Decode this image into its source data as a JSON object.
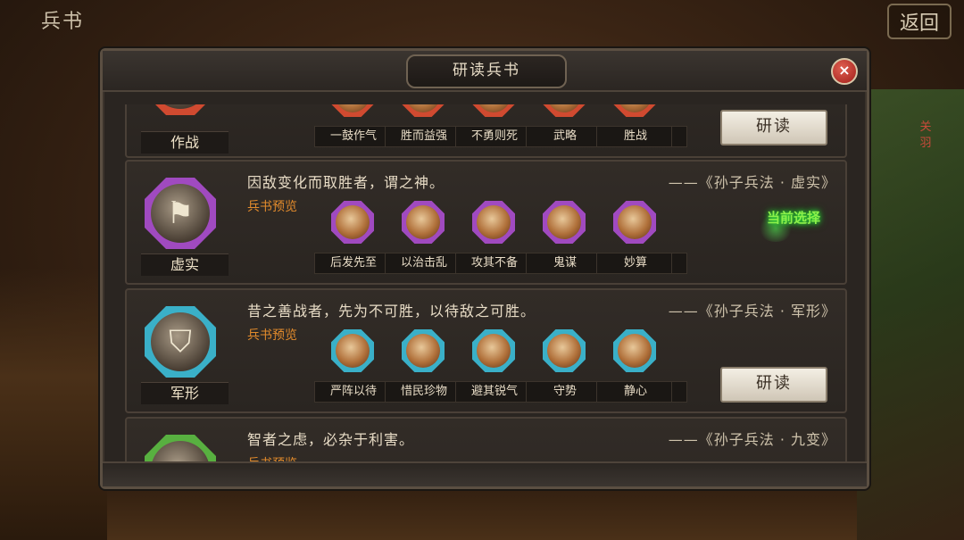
{
  "screen": {
    "corner_title": "兵书",
    "back_label": "返回",
    "side_tag": "关羽"
  },
  "dialog": {
    "title": "研读兵书",
    "close": "×"
  },
  "cards": [
    {
      "name": "作战",
      "quote": "",
      "source": "",
      "preview_label": "",
      "color": "#d04a30",
      "skills": [
        "一鼓作气",
        "胜而益强",
        "不勇则死",
        "武略",
        "胜战"
      ],
      "action": "研读"
    },
    {
      "name": "虚实",
      "quote": "因敌变化而取胜者，谓之神。",
      "source": "——《孙子兵法 · 虚实》",
      "preview_label": "兵书预览",
      "color": "#a04ac0",
      "skills": [
        "后发先至",
        "以治击乱",
        "攻其不备",
        "鬼谋",
        "妙算"
      ],
      "status": "当前选择"
    },
    {
      "name": "军形",
      "quote": "昔之善战者，先为不可胜，以待敌之可胜。",
      "source": "——《孙子兵法 · 军形》",
      "preview_label": "兵书预览",
      "color": "#3ab0c8",
      "skills": [
        "严阵以待",
        "惜民珍物",
        "避其锐气",
        "守势",
        "静心"
      ],
      "action": "研读"
    },
    {
      "name": "",
      "quote": "智者之虑，必杂于利害。",
      "source": "——《孙子兵法 · 九变》",
      "preview_label": "兵书预览",
      "color": "#58b040",
      "skills": []
    }
  ]
}
